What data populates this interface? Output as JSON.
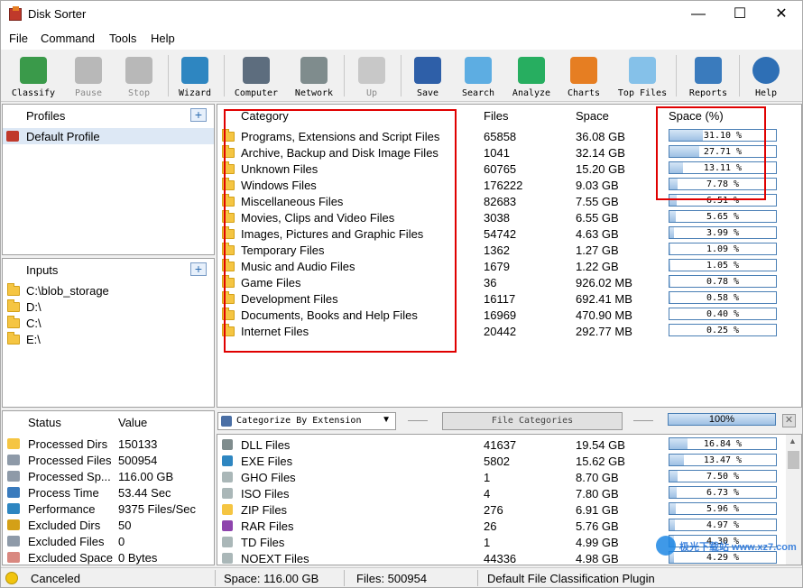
{
  "window": {
    "title": "Disk Sorter"
  },
  "menu": [
    "File",
    "Command",
    "Tools",
    "Help"
  ],
  "toolbar": [
    {
      "label": "Classify",
      "icon": "classify-icon",
      "enabled": true
    },
    {
      "label": "Pause",
      "icon": "pause-icon",
      "enabled": false
    },
    {
      "label": "Stop",
      "icon": "stop-icon",
      "enabled": false
    },
    {
      "label": "Wizard",
      "icon": "wizard-icon",
      "enabled": true
    },
    {
      "label": "Computer",
      "icon": "computer-icon",
      "enabled": true
    },
    {
      "label": "Network",
      "icon": "network-icon",
      "enabled": true
    },
    {
      "label": "Up",
      "icon": "up-arrow-icon",
      "enabled": false
    },
    {
      "label": "Save",
      "icon": "save-icon",
      "enabled": true
    },
    {
      "label": "Search",
      "icon": "search-icon",
      "enabled": true
    },
    {
      "label": "Analyze",
      "icon": "analyze-icon",
      "enabled": true
    },
    {
      "label": "Charts",
      "icon": "charts-icon",
      "enabled": true
    },
    {
      "label": "Top Files",
      "icon": "top-files-icon",
      "enabled": true
    },
    {
      "label": "Reports",
      "icon": "reports-icon",
      "enabled": true
    },
    {
      "label": "Help",
      "icon": "help-icon",
      "enabled": true
    }
  ],
  "profiles": {
    "header": "Profiles",
    "items": [
      "Default Profile"
    ]
  },
  "inputs": {
    "header": "Inputs",
    "items": [
      "C:\\blob_storage",
      "D:\\",
      "C:\\",
      "E:\\"
    ]
  },
  "status": {
    "headers": [
      "Status",
      "Value"
    ],
    "rows": [
      [
        "Processed Dirs",
        "150133"
      ],
      [
        "Processed Files",
        "500954"
      ],
      [
        "Processed Sp...",
        "116.00 GB"
      ],
      [
        "Process Time",
        "53.44 Sec"
      ],
      [
        "Performance",
        "9375 Files/Sec"
      ],
      [
        "Excluded Dirs",
        "50"
      ],
      [
        "Excluded Files",
        "0"
      ],
      [
        "Excluded Space",
        "0 Bytes"
      ]
    ]
  },
  "categories": {
    "headers": [
      "Category",
      "Files",
      "Space",
      "Space (%)"
    ],
    "rows": [
      [
        "Programs, Extensions and Script Files",
        "65858",
        "36.08 GB",
        31.1
      ],
      [
        "Archive, Backup and Disk Image Files",
        "1041",
        "32.14 GB",
        27.71
      ],
      [
        "Unknown Files",
        "60765",
        "15.20 GB",
        13.11
      ],
      [
        "Windows Files",
        "176222",
        "9.03 GB",
        7.78
      ],
      [
        "Miscellaneous Files",
        "82683",
        "7.55 GB",
        6.51
      ],
      [
        "Movies, Clips and Video Files",
        "3038",
        "6.55 GB",
        5.65
      ],
      [
        "Images, Pictures and Graphic Files",
        "54742",
        "4.63 GB",
        3.99
      ],
      [
        "Temporary Files",
        "1362",
        "1.27 GB",
        1.09
      ],
      [
        "Music and Audio Files",
        "1679",
        "1.22 GB",
        1.05
      ],
      [
        "Game Files",
        "36",
        "926.02 MB",
        0.78
      ],
      [
        "Development Files",
        "16117",
        "692.41 MB",
        0.58
      ],
      [
        "Documents, Books and Help Files",
        "16969",
        "470.90 MB",
        0.4
      ],
      [
        "Internet Files",
        "20442",
        "292.77 MB",
        0.25
      ]
    ]
  },
  "bottom": {
    "dropdown": "Categorize By Extension",
    "button": "File Categories",
    "total": "100%",
    "rows": [
      [
        "DLL Files",
        "41637",
        "19.54 GB",
        16.84
      ],
      [
        "EXE Files",
        "5802",
        "15.62 GB",
        13.47
      ],
      [
        "GHO Files",
        "1",
        "8.70 GB",
        7.5
      ],
      [
        "ISO Files",
        "4",
        "7.80 GB",
        6.73
      ],
      [
        "ZIP Files",
        "276",
        "6.91 GB",
        5.96
      ],
      [
        "RAR Files",
        "26",
        "5.76 GB",
        4.97
      ],
      [
        "TD Files",
        "1",
        "4.99 GB",
        4.3
      ],
      [
        "NOEXT Files",
        "44336",
        "4.98 GB",
        4.29
      ]
    ]
  },
  "statusbar": {
    "state": "Canceled",
    "space": "Space: 116.00 GB",
    "files": "Files: 500954",
    "plugin": "Default File Classification Plugin"
  },
  "watermark": "极光下载站 www.xz7.com"
}
